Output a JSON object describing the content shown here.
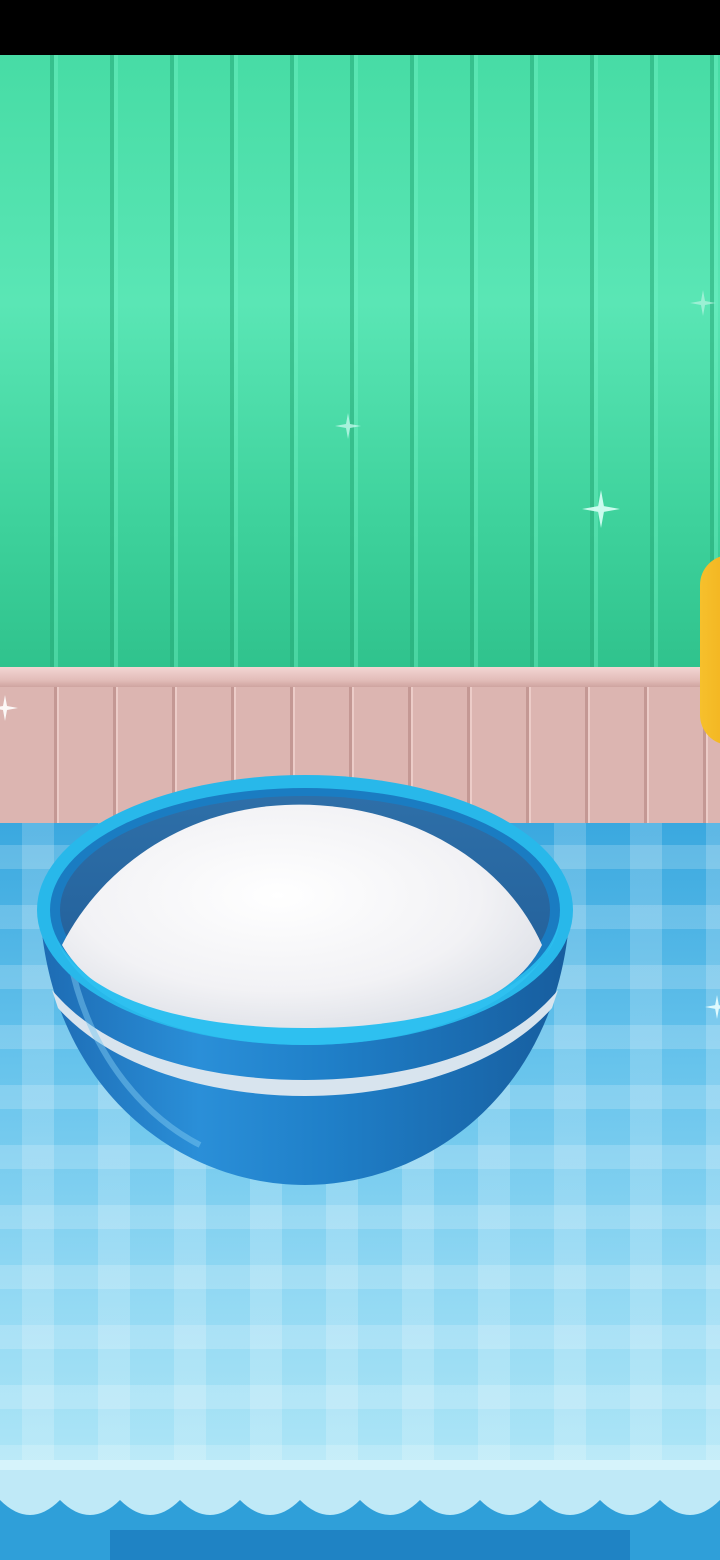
{
  "screen": {
    "name": "cooking-game-mixing-bowl",
    "icons": [
      "sparkle-icon",
      "mixing-bowl",
      "flour-mound"
    ]
  },
  "colors": {
    "wall": "#47dca5",
    "wainscot": "#d8b0ac",
    "table": "#66c3ec",
    "bowl": "#1f7fc8",
    "bowl_rim": "#28b8ea",
    "flour": "#f4f4f6",
    "accent_yellow": "#f6c02c"
  }
}
